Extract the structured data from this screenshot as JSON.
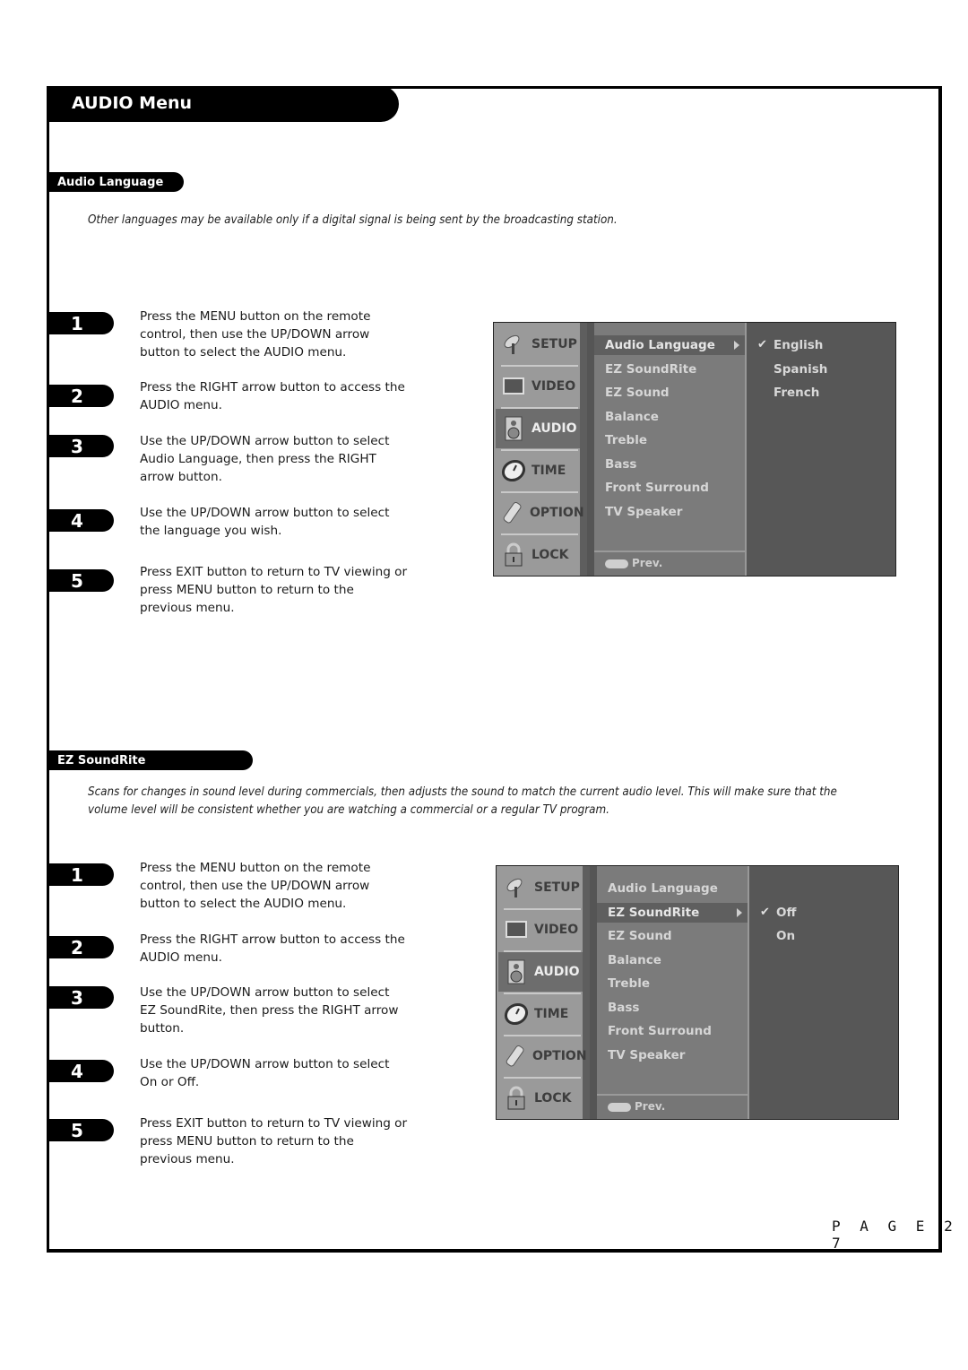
{
  "page": {
    "title": "AUDIO Menu",
    "page_label": "P A G E  2 7"
  },
  "sections": [
    {
      "tab": "Audio Language",
      "description": "Other languages may be available only if a digital signal is being sent by the broadcasting station.",
      "steps": [
        {
          "num": "1",
          "text": "Press the MENU button on the remote control, then use the UP/DOWN arrow button to select the AUDIO menu."
        },
        {
          "num": "2",
          "text": "Press the RIGHT arrow button to access the AUDIO menu."
        },
        {
          "num": "3",
          "text": "Use the UP/DOWN arrow button to select Audio Language, then press the RIGHT arrow button."
        },
        {
          "num": "4",
          "text": "Use the UP/DOWN arrow button to select the language you wish."
        },
        {
          "num": "5",
          "text": "Press EXIT button to return to TV viewing or press MENU button to return to the previous menu."
        }
      ],
      "osd": {
        "categories": [
          {
            "label": "SETUP",
            "icon": "satellite-dish-icon"
          },
          {
            "label": "VIDEO",
            "icon": "tv-screen-icon"
          },
          {
            "label": "AUDIO",
            "icon": "speaker-icon",
            "active": true
          },
          {
            "label": "TIME",
            "icon": "clock-icon"
          },
          {
            "label": "OPTION",
            "icon": "remote-icon"
          },
          {
            "label": "LOCK",
            "icon": "lock-icon"
          }
        ],
        "items": [
          "Audio Language",
          "EZ SoundRite",
          "EZ Sound",
          "Balance",
          "Treble",
          "Bass",
          "Front Surround",
          "TV Speaker"
        ],
        "selected_item": "Audio Language",
        "options": [
          "English",
          "Spanish",
          "French"
        ],
        "checked_option": "English",
        "check_mark": "✔",
        "prev_label": "Prev."
      }
    },
    {
      "tab": "EZ SoundRite",
      "description": "Scans for changes in sound level during commercials, then adjusts the sound to match the current audio level. This will make sure that the volume level will be consistent whether you are watching a commercial or a regular TV program.",
      "steps": [
        {
          "num": "1",
          "text": "Press the MENU button on the remote control, then use the UP/DOWN arrow button to select the AUDIO menu."
        },
        {
          "num": "2",
          "text": "Press the RIGHT arrow button to access the AUDIO menu."
        },
        {
          "num": "3",
          "text": "Use the UP/DOWN arrow button to select EZ SoundRite, then press the RIGHT arrow button."
        },
        {
          "num": "4",
          "text": "Use the UP/DOWN arrow button to select On or Off."
        },
        {
          "num": "5",
          "text": "Press EXIT button to return to TV viewing or press MENU button to return to the previous menu."
        }
      ],
      "osd": {
        "categories": [
          {
            "label": "SETUP",
            "icon": "satellite-dish-icon"
          },
          {
            "label": "VIDEO",
            "icon": "tv-screen-icon"
          },
          {
            "label": "AUDIO",
            "icon": "speaker-icon",
            "active": true
          },
          {
            "label": "TIME",
            "icon": "clock-icon"
          },
          {
            "label": "OPTION",
            "icon": "remote-icon"
          },
          {
            "label": "LOCK",
            "icon": "lock-icon"
          }
        ],
        "items": [
          "Audio Language",
          "EZ SoundRite",
          "EZ Sound",
          "Balance",
          "Treble",
          "Bass",
          "Front Surround",
          "TV Speaker"
        ],
        "selected_item": "EZ SoundRite",
        "options": [
          "Off",
          "On"
        ],
        "checked_option": "Off",
        "check_mark": "✔",
        "prev_label": "Prev."
      }
    }
  ]
}
